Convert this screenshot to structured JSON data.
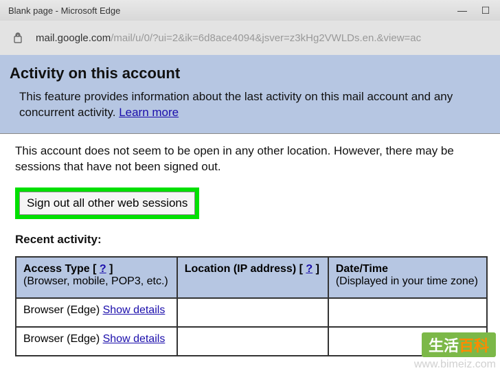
{
  "window": {
    "title": "Blank page - Microsoft Edge"
  },
  "address": {
    "host": "mail.google.com",
    "path": "/mail/u/0/?ui=2&ik=6d8ace4094&jsver=z3kHg2VWLDs.en.&view=ac"
  },
  "header": {
    "title": "Activity on this account",
    "description_pre": "This feature provides information about the last activity on this mail account and any concurrent activity. ",
    "learn_more": "Learn more"
  },
  "status": {
    "text": "This account does not seem to be open in any other location. However, there may be sessions that have not been signed out.",
    "signout_label": "Sign out all other web sessions"
  },
  "recent": {
    "title": "Recent activity:",
    "columns": {
      "access_label": "Access Type",
      "access_help": "?",
      "access_sub": "(Browser, mobile, POP3, etc.)",
      "location_label": "Location (IP address)",
      "location_help": "?",
      "datetime_label": "Date/Time",
      "datetime_sub": "(Displayed in your time zone)"
    },
    "rows": [
      {
        "access": "Browser (Edge) ",
        "details": "Show details"
      },
      {
        "access": "Browser (Edge) ",
        "details": "Show details"
      }
    ]
  },
  "watermark": {
    "text_a": "生活",
    "text_b": "百科",
    "url": "www.bimeiz.com"
  }
}
